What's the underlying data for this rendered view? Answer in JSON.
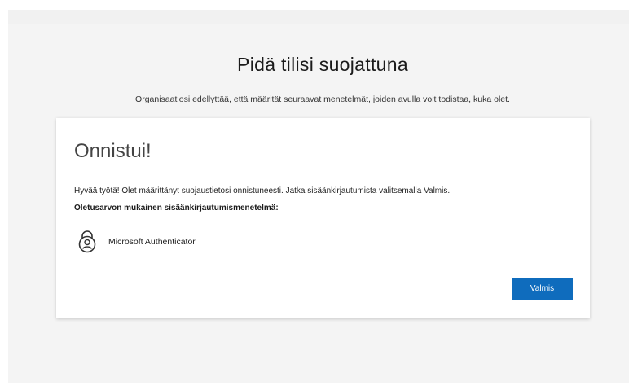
{
  "page": {
    "title": "Pidä tilisi suojattuna",
    "subtitle": "Organisaatiosi edellyttää, että määrität seuraavat menetelmät, joiden avulla voit todistaa, kuka olet."
  },
  "card": {
    "title": "Onnistui!",
    "message": "Hyvää työtä! Olet määrittänyt suojaustietosi onnistuneesti. Jatka sisäänkirjautumista valitsemalla Valmis.",
    "default_method_heading": "Oletusarvon mukainen sisäänkirjautumismenetelmä:",
    "method": {
      "icon": "authenticator-lock-icon",
      "label": "Microsoft Authenticator"
    },
    "done_label": "Valmis"
  },
  "colors": {
    "accent": "#0f6cbd",
    "background": "#f4f4f4",
    "card": "#ffffff"
  }
}
